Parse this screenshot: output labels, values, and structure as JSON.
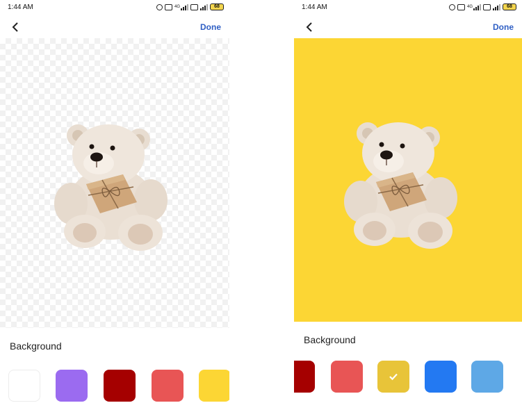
{
  "colors": {
    "accent": "#2f5fc4",
    "yellow_bg": "#fcd634",
    "white": "#ffffff",
    "purple": "#9b6bf0",
    "dark_red": "#a50000",
    "red": "#e85555",
    "yellow": "#fcd634",
    "mustard": "#e8c439",
    "blue": "#2379f2",
    "light_blue": "#5ea8e6"
  },
  "left_screen": {
    "status": {
      "time": "1:44 AM",
      "network": "4G",
      "battery": "68"
    },
    "nav": {
      "back_icon": "chevron-left-icon",
      "done_label": "Done"
    },
    "canvas": {
      "background": "transparent"
    },
    "panel": {
      "title": "Background",
      "swatches": [
        {
          "name": "white",
          "selected": false
        },
        {
          "name": "purple",
          "selected": false
        },
        {
          "name": "dark-red",
          "selected": false
        },
        {
          "name": "red",
          "selected": false
        },
        {
          "name": "yellow",
          "selected": false
        }
      ]
    }
  },
  "right_screen": {
    "status": {
      "time": "1:44 AM",
      "network": "4G",
      "battery": "68"
    },
    "nav": {
      "back_icon": "chevron-left-icon",
      "done_label": "Done"
    },
    "canvas": {
      "background": "yellow"
    },
    "panel": {
      "title": "Background",
      "swatches": [
        {
          "name": "dark-red",
          "selected": false
        },
        {
          "name": "red",
          "selected": false
        },
        {
          "name": "mustard",
          "selected": true,
          "icon": "checkmark-icon"
        },
        {
          "name": "blue",
          "selected": false
        },
        {
          "name": "light-blue",
          "selected": false
        }
      ]
    }
  }
}
